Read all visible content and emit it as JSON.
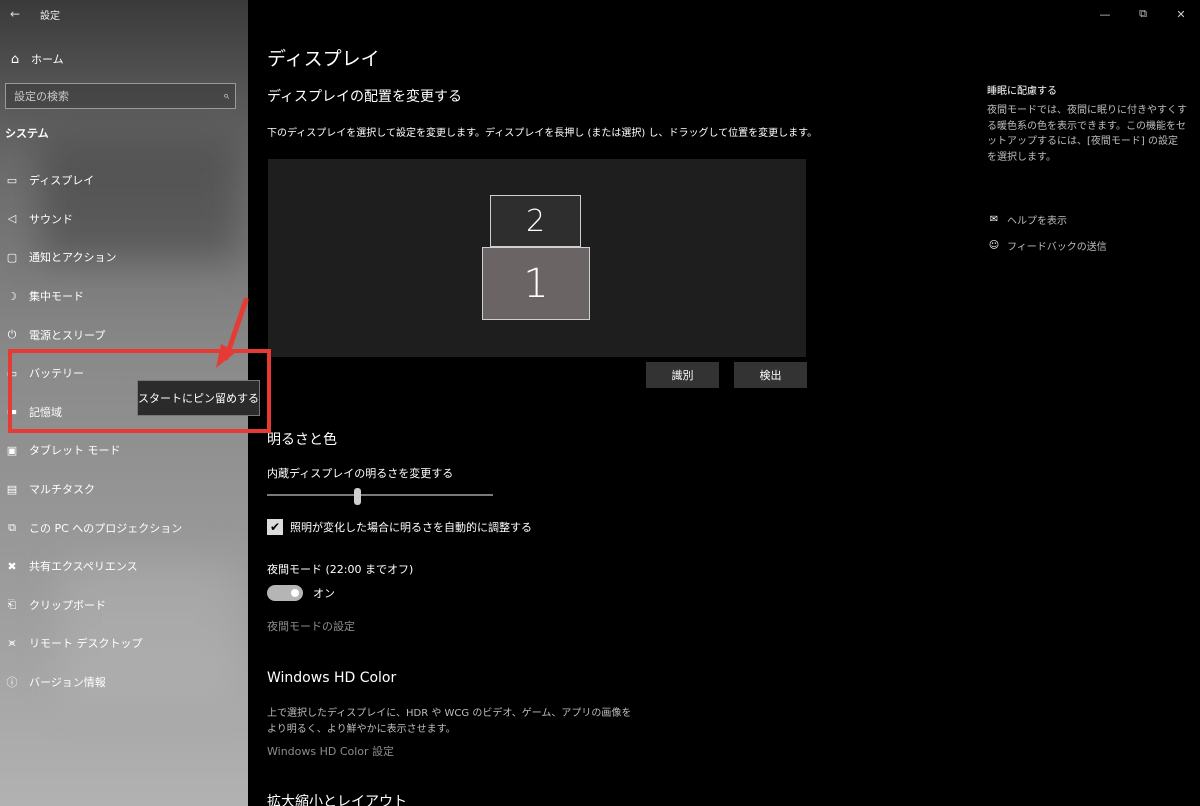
{
  "window": {
    "title": "設定",
    "back_icon": "back-arrow-icon",
    "controls": [
      "minimize",
      "restore",
      "close"
    ]
  },
  "sidebar": {
    "home_label": "ホーム",
    "search_placeholder": "設定の検索",
    "section": "システム",
    "items": [
      {
        "label": "ディスプレイ",
        "icon": "monitor-icon"
      },
      {
        "label": "サウンド",
        "icon": "speaker-icon"
      },
      {
        "label": "通知とアクション",
        "icon": "notification-icon"
      },
      {
        "label": "集中モード",
        "icon": "moon-icon"
      },
      {
        "label": "電源とスリープ",
        "icon": "power-icon"
      },
      {
        "label": "バッテリー",
        "icon": "battery-icon"
      },
      {
        "label": "記憶域",
        "icon": "storage-icon"
      },
      {
        "label": "タブレット モード",
        "icon": "tablet-icon"
      },
      {
        "label": "マルチタスク",
        "icon": "multitask-icon"
      },
      {
        "label": "この PC へのプロジェクション",
        "icon": "projection-icon"
      },
      {
        "label": "共有エクスペリエンス",
        "icon": "shared-icon"
      },
      {
        "label": "クリップボード",
        "icon": "clipboard-icon"
      },
      {
        "label": "リモート デスクトップ",
        "icon": "remote-desktop-icon"
      },
      {
        "label": "バージョン情報",
        "icon": "info-icon"
      }
    ],
    "tooltip": "スタートにピン留めする"
  },
  "main": {
    "title": "ディスプレイ",
    "arrange": {
      "heading": "ディスプレイの配置を変更する",
      "description": "下のディスプレイを選択して設定を変更します。ディスプレイを長押し (または選択) し、ドラッグして位置を変更します。",
      "monitor_1": "1",
      "monitor_2": "2",
      "identify_button": "識別",
      "detect_button": "検出"
    },
    "brightness": {
      "heading": "明るさと色",
      "slider_label": "内蔵ディスプレイの明るさを変更する",
      "slider_value_percent": 40,
      "checkbox_label": "照明が変化した場合に明るさを自動的に調整する",
      "checkbox_checked": true,
      "night_mode_label": "夜間モード (22:00 までオフ)",
      "toggle_label": "オン",
      "toggle_on": true,
      "night_mode_settings_link": "夜間モードの設定"
    },
    "hdr": {
      "heading": "Windows HD Color",
      "description_line1": "上で選択したディスプレイに、HDR や WCG のビデオ、ゲーム、アプリの画像を",
      "description_line2": "より明るく、より鮮やかに表示させます。",
      "settings_link": "Windows HD Color 設定"
    },
    "scale_heading": "拡大縮小とレイアウト"
  },
  "right": {
    "title": "睡眠に配慮する",
    "description": "夜間モードでは、夜間に眠りに付きやすくする暖色系の色を表示できます。この機能をセットアップするには、[夜間モード] の設定を選択します。",
    "help_link": "ヘルプを表示",
    "feedback_link": "フィードバックの送信"
  },
  "colors": {
    "annotation_red": "#e63b35",
    "monitor_1_fill": "#6b6464",
    "monitor_2_fill": "#2e2e2e"
  }
}
